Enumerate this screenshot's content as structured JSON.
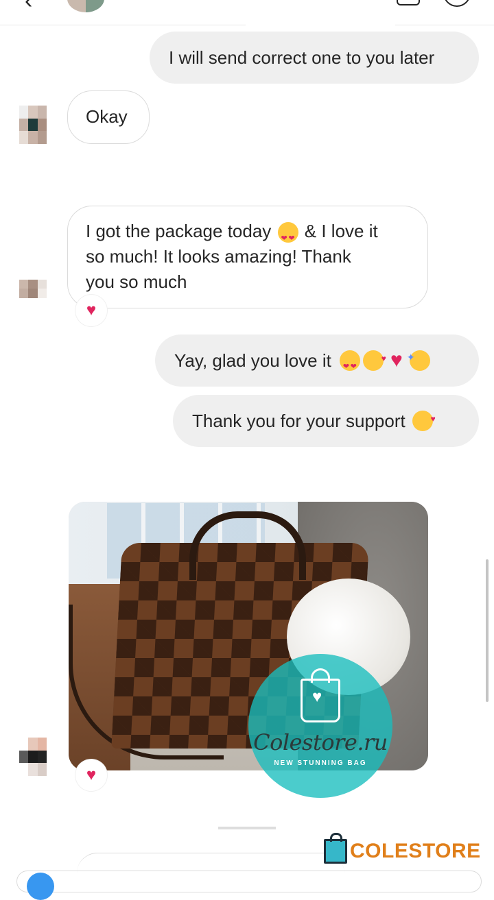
{
  "messages": [
    {
      "dir": "out",
      "text": "I will send correct one to you later"
    },
    {
      "dir": "in",
      "text": "Okay"
    },
    {
      "dir": "in",
      "text": "I got the package today",
      "text2": "& I love it",
      "line2": "so much! It looks amazing! Thank",
      "line3": "you so much",
      "reaction": "heart"
    },
    {
      "dir": "out",
      "text": "Yay, glad you love it"
    },
    {
      "dir": "out",
      "text": "Thank you for your support"
    },
    {
      "dir": "in",
      "type": "photo",
      "reaction": "heart"
    }
  ],
  "watermark": {
    "name": "Colestore.ru",
    "tagline": "NEW STUNNING BAG"
  },
  "brand": {
    "name": "COLESTORE"
  },
  "icons": [
    "back-arrow-icon",
    "video-call-icon",
    "info-icon",
    "heart-icon",
    "heart-eyes-emoji",
    "smiling-hearts-emoji",
    "red-heart-emoji",
    "party-face-emoji",
    "shopping-bag-icon",
    "camera-icon"
  ],
  "colors": {
    "accent_heart": "#e0245e",
    "brand_orange": "#e07f1a",
    "watermark_teal": "#18bebe",
    "outgoing_bubble": "#efefef"
  }
}
